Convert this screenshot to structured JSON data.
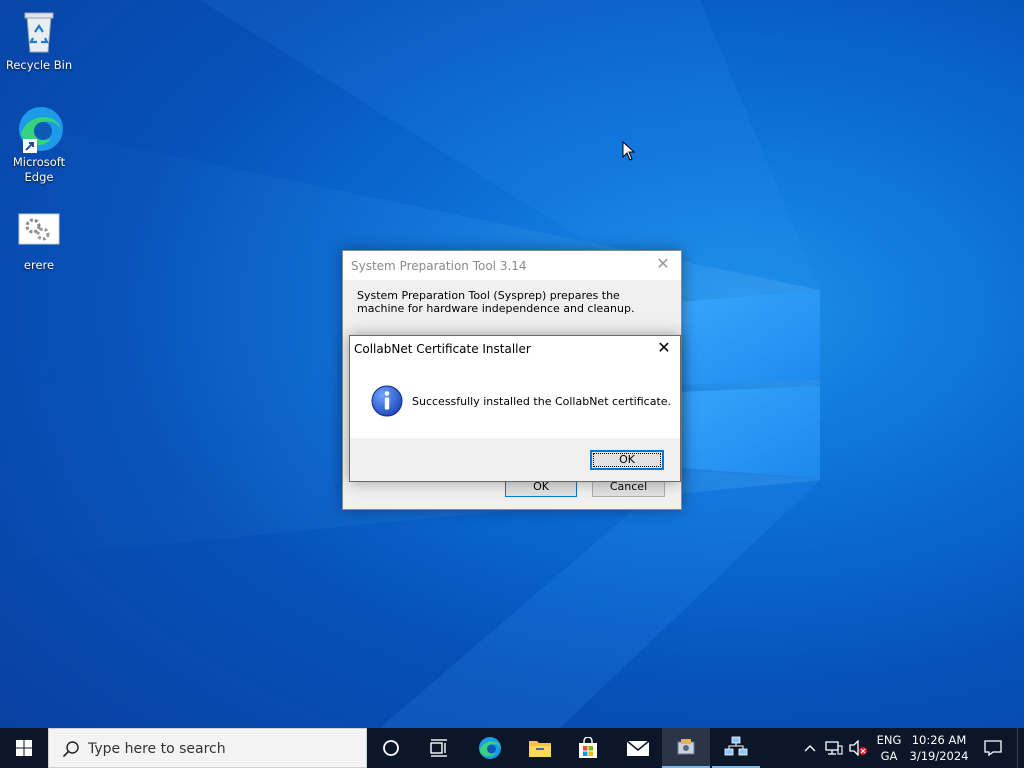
{
  "desktop": {
    "icons": [
      {
        "name": "recycle-bin",
        "label": "Recycle Bin"
      },
      {
        "name": "microsoft-edge",
        "label": "Microsoft Edge"
      },
      {
        "name": "erere",
        "label": "erere"
      }
    ]
  },
  "sysprep": {
    "title": "System Preparation Tool 3.14",
    "description": "System Preparation Tool (Sysprep) prepares the machine for hardware independence and cleanup.",
    "ok_label": "OK",
    "cancel_label": "Cancel"
  },
  "dialog": {
    "title": "CollabNet Certificate Installer",
    "message": "Successfully installed the CollabNet certificate.",
    "ok_label": "OK",
    "icon": "info-icon"
  },
  "taskbar": {
    "search_placeholder": "Type here to search",
    "language_line1": "ENG",
    "language_line2": "GA",
    "time": "10:26 AM",
    "date": "3/19/2024"
  },
  "colors": {
    "accent": "#0078d7",
    "taskbar": "#0b1629",
    "desktop": "#0a64c8"
  }
}
